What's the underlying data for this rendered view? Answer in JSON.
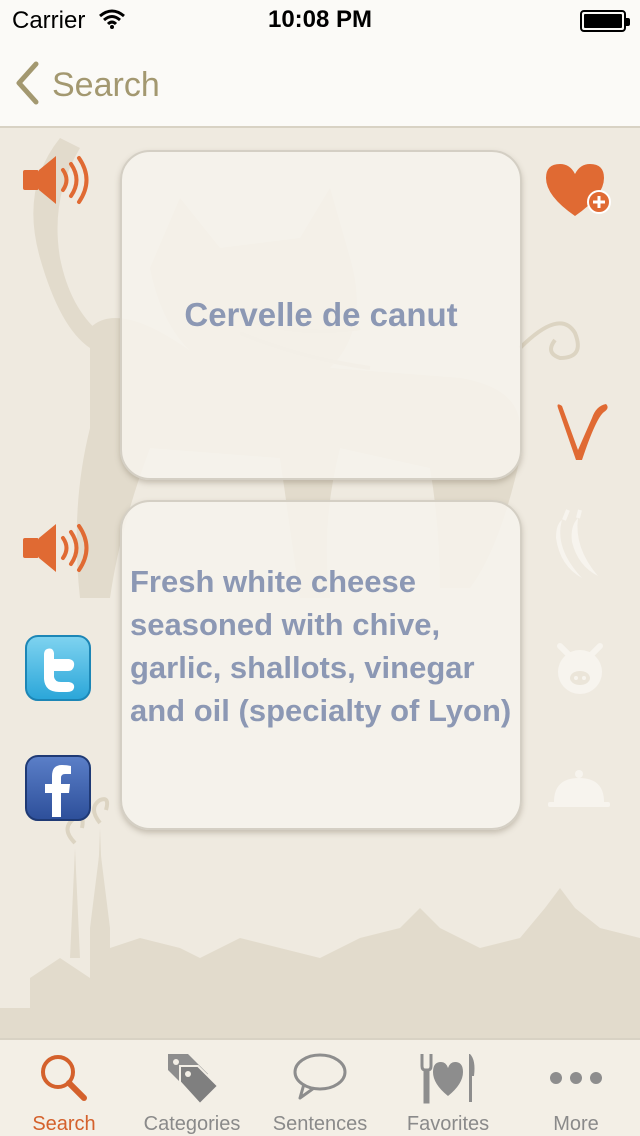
{
  "status_bar": {
    "carrier": "Carrier",
    "time": "10:08 PM",
    "battery_percent": 100
  },
  "nav": {
    "back_label": "Search"
  },
  "entry": {
    "term": "Cervelle de canut",
    "definition": "Fresh white cheese seasoned with chive, garlic, shallots, vinegar and oil (specialty of Lyon)"
  },
  "side_icons": {
    "left": [
      "speaker-icon",
      "speaker-icon",
      "twitter-icon",
      "facebook-icon"
    ],
    "right": [
      "add-favorite-heart-icon",
      "vegetarian-v-icon",
      "chili-pepper-icon",
      "pig-icon",
      "cloche-icon"
    ]
  },
  "tabs": [
    {
      "label": "Search",
      "icon": "search-icon",
      "active": true
    },
    {
      "label": "Categories",
      "icon": "tags-icon",
      "active": false
    },
    {
      "label": "Sentences",
      "icon": "speech-bubble-icon",
      "active": false
    },
    {
      "label": "Favorites",
      "icon": "heart-fork-knife-icon",
      "active": false
    },
    {
      "label": "More",
      "icon": "more-dots-icon",
      "active": false
    }
  ],
  "colors": {
    "accent": "#d4612c",
    "text_blue": "#8c98b4",
    "nav_tint": "#a39870",
    "background": "#efeae0"
  }
}
